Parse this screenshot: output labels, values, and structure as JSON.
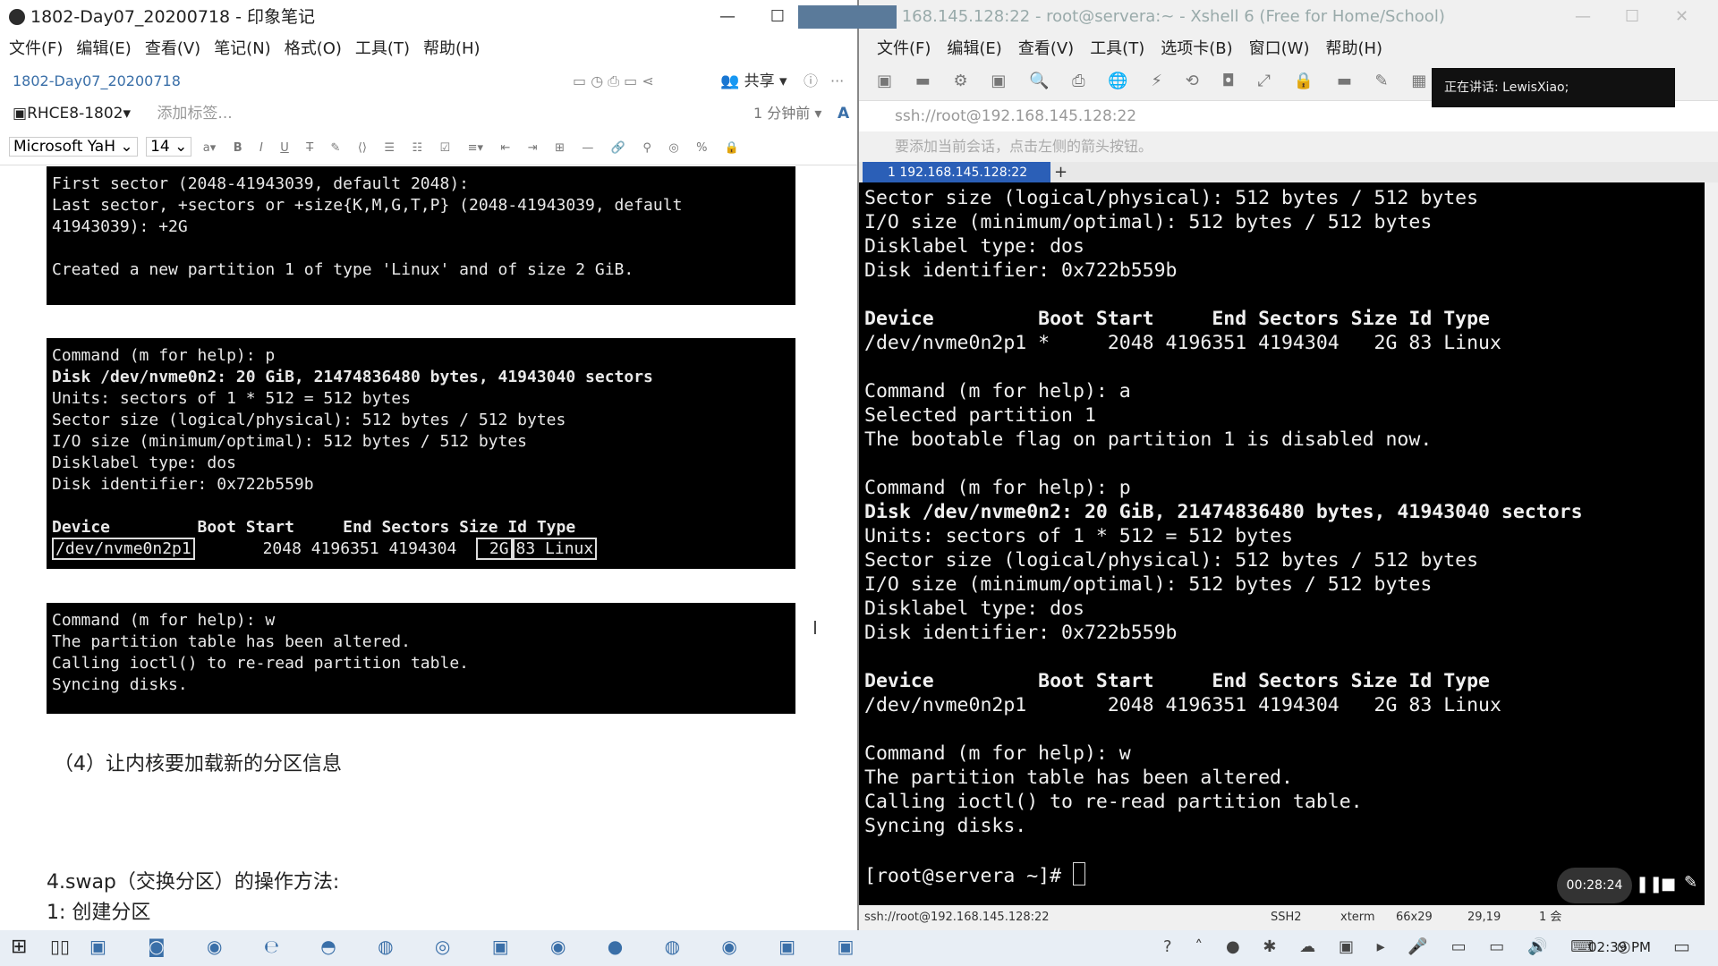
{
  "left_window": {
    "title": "1802-Day07_20200718 - 印象笔记",
    "menu": [
      "文件(F)",
      "编辑(E)",
      "查看(V)",
      "笔记(N)",
      "格式(O)",
      "工具(T)",
      "帮助(H)"
    ],
    "note_name": "1802-Day07_20200718",
    "share_label": "共享",
    "notebook": "RHCE8-1802",
    "add_tag_placeholder": "添加标签...",
    "edited_time": "1 分钟前",
    "font_name": "Microsoft YaH",
    "font_size": "14",
    "code1": "First sector (2048-41943039, default 2048):\nLast sector, +sectors or +size{K,M,G,T,P} (2048-41943039, default\n41943039): +2G\n\nCreated a new partition 1 of type 'Linux' and of size 2 GiB.",
    "code2_cmd": "Command (m for help): p",
    "code2_disk": "Disk /dev/nvme0n2: 20 GiB, 21474836480 bytes, 41943040 sectors",
    "code2_rest": "Units: sectors of 1 * 512 = 512 bytes\nSector size (logical/physical): 512 bytes / 512 bytes\nI/O size (minimum/optimal): 512 bytes / 512 bytes\nDisklabel type: dos\nDisk identifier: 0x722b559b",
    "code2_header": "Device         Boot Start     End Sectors Size Id Type",
    "code2_dev": "/dev/nvme0n2p1",
    "code2_nums": "       2048 4196351 4194304",
    "code2_size": " 2G",
    "code2_type": "83 Linux",
    "code3": "Command (m for help): w\nThe partition table has been altered.\nCalling ioctl() to re-read partition table.\nSyncing disks.",
    "step4": "（4）让内核要加载新的分区信息",
    "section_swap": "4.swap（交换分区）的操作方法:",
    "step1": "1: 创建分区"
  },
  "right_window": {
    "title": "168.145.128:22 - root@servera:~ - Xshell 6 (Free for Home/School)",
    "menu": [
      "文件(F)",
      "编辑(E)",
      "查看(V)",
      "工具(T)",
      "选项卡(B)",
      "窗口(W)",
      "帮助(H)"
    ],
    "address": "ssh://root@192.168.145.128:22",
    "hint": "要添加当前会话，点击左侧的箭头按钮。",
    "speaking": "正在讲话: LewisXiao;",
    "tab_label": "1 192.168.145.128:22",
    "terminal_text": "Sector size (logical/physical): 512 bytes / 512 bytes\nI/O size (minimum/optimal): 512 bytes / 512 bytes\nDisklabel type: dos\nDisk identifier: 0x722b559b\n\n",
    "term_header1": "Device         Boot Start     End Sectors Size Id Type",
    "term_row1": "/dev/nvme0n2p1 *     2048 4196351 4194304   2G 83 Linux",
    "term_mid": "\nCommand (m for help): a\nSelected partition 1\nThe bootable flag on partition 1 is disabled now.\n\nCommand (m for help): p",
    "term_disk": "Disk /dev/nvme0n2: 20 GiB, 21474836480 bytes, 41943040 sectors",
    "term_mid2": "Units: sectors of 1 * 512 = 512 bytes\nSector size (logical/physical): 512 bytes / 512 bytes\nI/O size (minimum/optimal): 512 bytes / 512 bytes\nDisklabel type: dos\nDisk identifier: 0x722b559b\n",
    "term_header2": "Device         Boot Start     End Sectors Size Id Type",
    "term_row2": "/dev/nvme0n2p1       2048 4196351 4194304   2G 83 Linux",
    "term_end": "\nCommand (m for help): w\nThe partition table has been altered.\nCalling ioctl() to re-read partition table.\nSyncing disks.\n\n[root@servera ~]# ",
    "status": {
      "address": "ssh://root@192.168.145.128:22",
      "protocol": "SSH2",
      "term": "xterm",
      "size": "66x29",
      "cursor": "29,19",
      "sessions": "1 会"
    },
    "recording_time": "00:28:24"
  },
  "taskbar": {
    "clock": "02:39 PM"
  }
}
